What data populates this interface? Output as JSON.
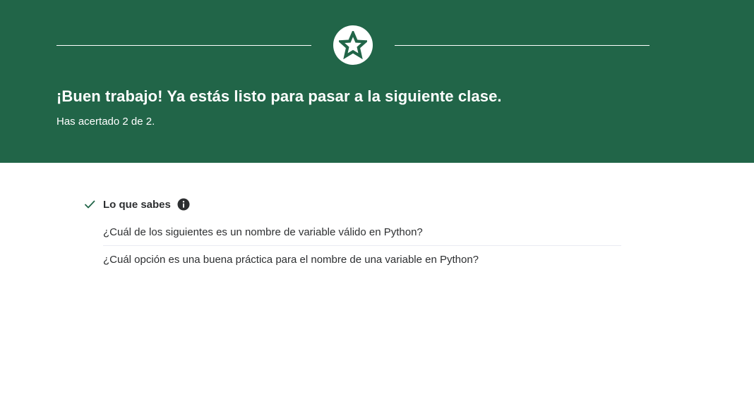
{
  "banner": {
    "headline": "¡Buen trabajo! Ya estás listo para pasar a la siguiente clase.",
    "score": "Has acertado 2 de 2.",
    "icon": "star-icon",
    "background_color": "#216548"
  },
  "results": {
    "section_title": "Lo que sabes",
    "status_icon": "check-icon",
    "info_icon": "info-icon",
    "questions": [
      "¿Cuál de los siguientes es un nombre de variable válido en Python?",
      "¿Cuál opción es una buena práctica para el nombre de una variable en Python?"
    ]
  }
}
